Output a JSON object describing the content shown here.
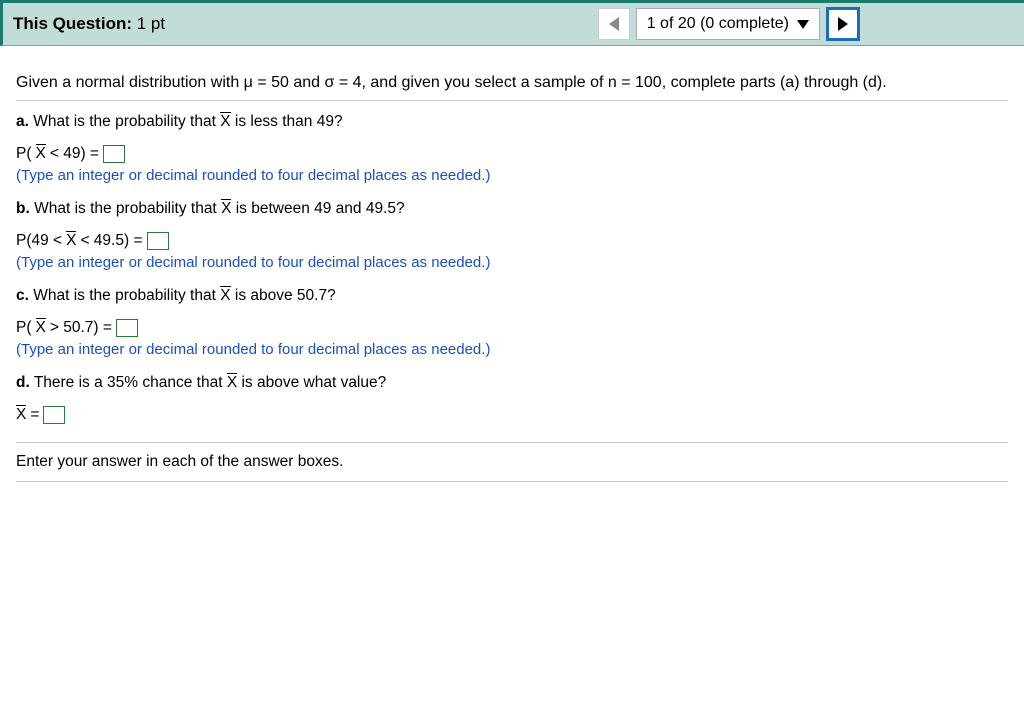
{
  "header": {
    "title_label": "This Question:",
    "points": "1 pt",
    "progress": "1 of 20 (0 complete)"
  },
  "intro": "Given a normal distribution with μ = 50 and σ = 4, and given you select a sample of n = 100, complete parts (a) through (d).",
  "parts": {
    "a": {
      "label": "a.",
      "question_pre": "What is the probability that ",
      "question_post": " is less than 49?",
      "eq_pre": "P(",
      "eq_mid": " < 49) = ",
      "hint": "(Type an integer or decimal rounded to four decimal places as needed.)"
    },
    "b": {
      "label": "b.",
      "question_pre": "What is the probability that ",
      "question_post": " is between 49 and 49.5?",
      "eq_pre": "P(49 < ",
      "eq_mid": " < 49.5) = ",
      "hint": "(Type an integer or decimal rounded to four decimal places as needed.)"
    },
    "c": {
      "label": "c.",
      "question_pre": "What is the probability that ",
      "question_post": " is above 50.7?",
      "eq_pre": "P(",
      "eq_mid": " > 50.7) = ",
      "hint": "(Type an integer or decimal rounded to four decimal places as needed.)"
    },
    "d": {
      "label": "d.",
      "question_pre": "There is a 35% chance that ",
      "question_post": " is above what value?",
      "eq_mid": " = "
    }
  },
  "footer": "Enter your answer in each of the answer boxes.",
  "glyphs": {
    "xbar": "X"
  }
}
